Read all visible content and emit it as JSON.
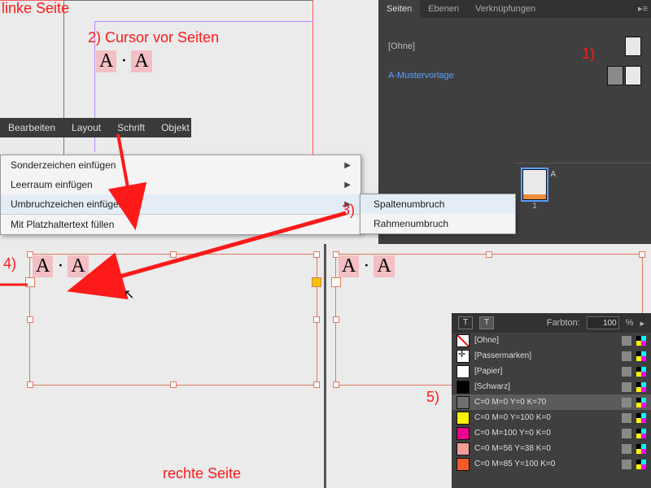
{
  "annotations": {
    "linke": "linke Seite",
    "cursor": "2) Cursor vor Seiten",
    "a1": "1)",
    "a3": "3)",
    "a4": "4)",
    "a5": "5)",
    "rechte": "rechte Seite"
  },
  "menubar": {
    "edit": "Bearbeiten",
    "layout": "Layout",
    "type": "Schrift",
    "object": "Objekt"
  },
  "menu": {
    "special": "Sonderzeichen einfügen",
    "white": "Leerraum einfügen",
    "break": "Umbruchzeichen einfügen",
    "placeholder": "Mit Platzhaltertext füllen"
  },
  "submenu": {
    "col": "Spaltenumbruch",
    "frame": "Rahmenumbruch"
  },
  "pagesPanel": {
    "tabs": {
      "pages": "Seiten",
      "layers": "Ebenen",
      "links": "Verknüpfungen"
    },
    "none": "[Ohne]",
    "master": "A-Mustervorlage",
    "pageLetter": "A",
    "pageNum": "1"
  },
  "swatches": {
    "tint_label": "Farbton:",
    "tint_value": "100",
    "pct": "%",
    "rows": [
      {
        "name": "[Ohne]",
        "chip": "none"
      },
      {
        "name": "[Passermarken]",
        "chip": "reg"
      },
      {
        "name": "[Papier]",
        "color": "#ffffff"
      },
      {
        "name": "[Schwarz]",
        "color": "#000000"
      },
      {
        "name": "C=0 M=0 Y=0 K=70",
        "color": "#6f6f6f",
        "sel": true
      },
      {
        "name": "C=0 M=0 Y=100 K=0",
        "color": "#fff200"
      },
      {
        "name": "C=0 M=100 Y=0 K=0",
        "color": "#ec008c"
      },
      {
        "name": "C=0 M=56 Y=38 K=0",
        "color": "#f19d9a"
      },
      {
        "name": "C=0 M=85 Y=100 K=0",
        "color": "#f15a29"
      }
    ]
  },
  "aa": {
    "a": "A",
    "dot": "·"
  }
}
